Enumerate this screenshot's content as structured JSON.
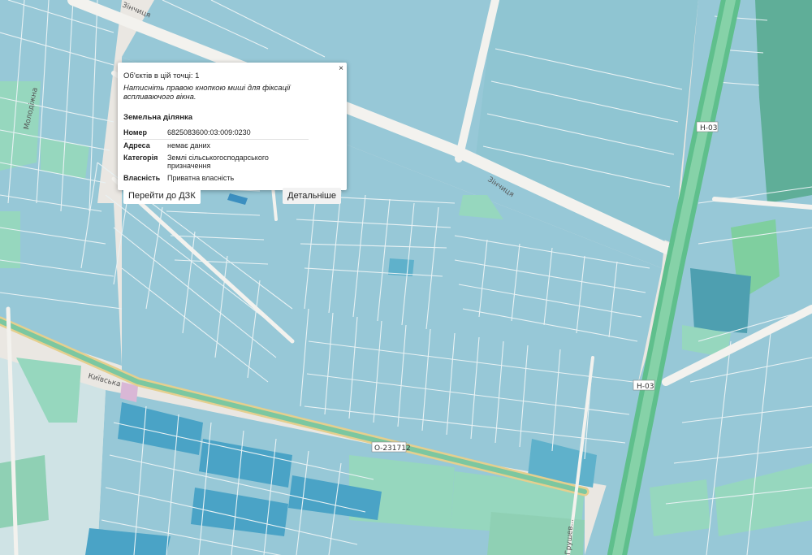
{
  "map": {
    "road_labels": [
      "Зінчиця",
      "Зінчиця",
      "Молодіжна",
      "Київська",
      "Грушев..."
    ],
    "badges": [
      "Н-03",
      "Н-03",
      "О-231712"
    ],
    "colors": {
      "background": "#eae7e2",
      "parcel_blue": "#97c8d7",
      "parcel_dark": "#5fb1cb",
      "parcel_green": "#96d7be",
      "forest": "#3f9f7e",
      "highway": "#77c498",
      "road": "#f3f2ee"
    }
  },
  "popup": {
    "close_label": "×",
    "count_label": "Об'єктів в цій точці: 1",
    "hint": "Натисніть правою кнопкою миші для фіксації вспливаючого вікна.",
    "section": "Земельна ділянка",
    "fields": [
      {
        "key": "Номер",
        "value": "6825083600:03:009:0230"
      },
      {
        "key": "Адреса",
        "value": "немає даних"
      },
      {
        "key": "Категорія",
        "value": "Землі сільськогосподарського призначення"
      },
      {
        "key": "Власність",
        "value": "Приватна власність"
      }
    ],
    "goto_button": "Перейти до ДЗК",
    "details_button": "Детальніше"
  }
}
